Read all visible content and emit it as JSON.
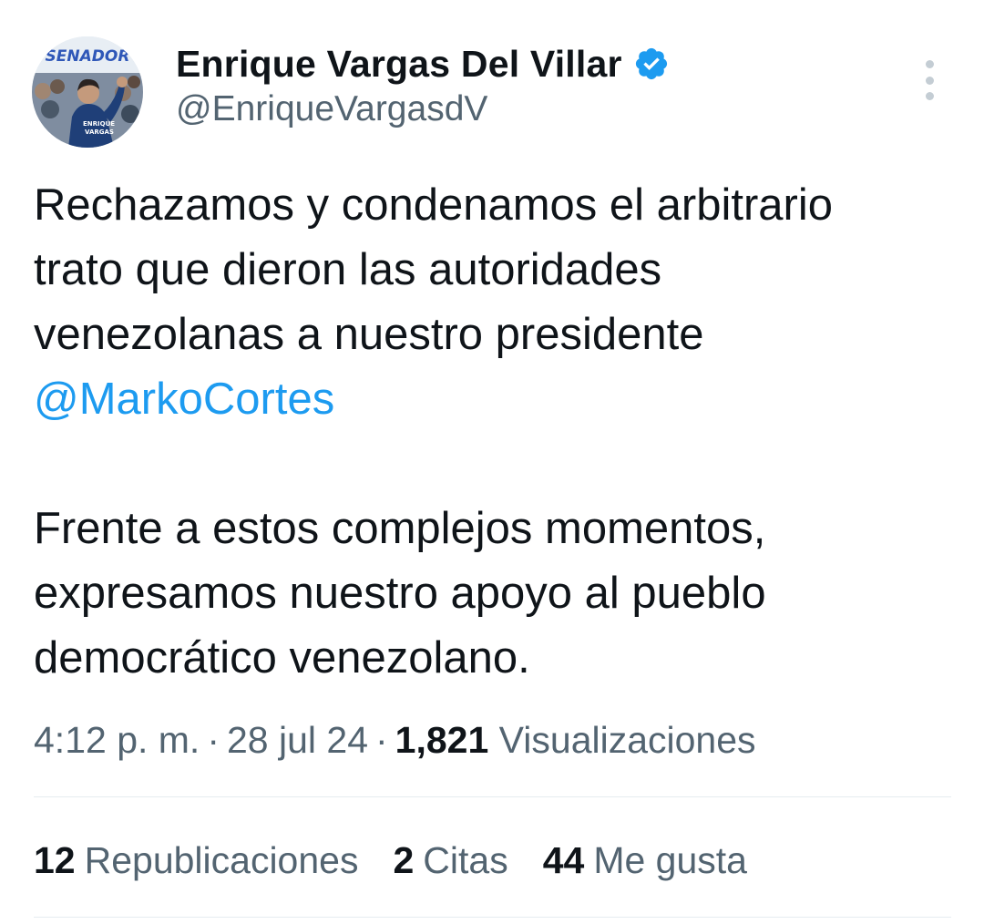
{
  "author": {
    "display_name": "Enrique Vargas Del Villar",
    "handle": "@EnriqueVargasdV",
    "verified": true,
    "avatar_text": "SENADOR"
  },
  "tweet": {
    "lines": [
      "Rechazamos y condenamos el arbitrario",
      "trato que dieron las autoridades",
      "venezolanas a nuestro presidente"
    ],
    "mention": "@MarkoCortes",
    "lines2": [
      "Frente a estos complejos momentos,",
      "expresamos nuestro apoyo al pueblo",
      "democrático venezolano."
    ]
  },
  "meta": {
    "time": "4:12 p. m.",
    "separator": "·",
    "date": "28 jul 24",
    "views_count": "1,821",
    "views_label": "Visualizaciones"
  },
  "stats": {
    "reposts_count": "12",
    "reposts_label": "Republicaciones",
    "quotes_count": "2",
    "quotes_label": "Citas",
    "likes_count": "44",
    "likes_label": "Me gusta"
  },
  "icons": {
    "verified": "verified-badge-icon",
    "more": "more-options-icon"
  },
  "colors": {
    "link": "#1d9bf0",
    "secondary_text": "#536471",
    "primary_text": "#0f1419"
  }
}
